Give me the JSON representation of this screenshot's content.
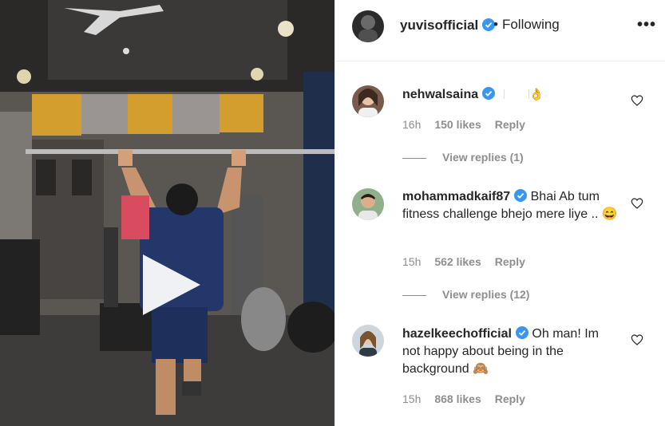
{
  "post": {
    "username": "yuvisofficial",
    "follow_status": "Following",
    "more_icon": "more-options-icon"
  },
  "comments": [
    {
      "username": "nehwalsaina",
      "text": "",
      "time": "16h",
      "likes": "150 likes",
      "reply": "Reply",
      "view_replies": "View replies (1)"
    },
    {
      "username": "mohammadkaif87",
      "text": "Bhai Ab tum fitness challenge bhejo mere liye .. 😄",
      "time": "15h",
      "likes": "562 likes",
      "reply": "Reply",
      "view_replies": "View replies (12)"
    },
    {
      "username": "hazelkeechofficial",
      "text": "Oh man! Im not happy about being in the background 🙈",
      "time": "15h",
      "likes": "868 likes",
      "reply": "Reply"
    }
  ],
  "colors": {
    "verified": "#3897f0",
    "meta_text": "#8e8e8e",
    "primary_text": "#262626"
  }
}
